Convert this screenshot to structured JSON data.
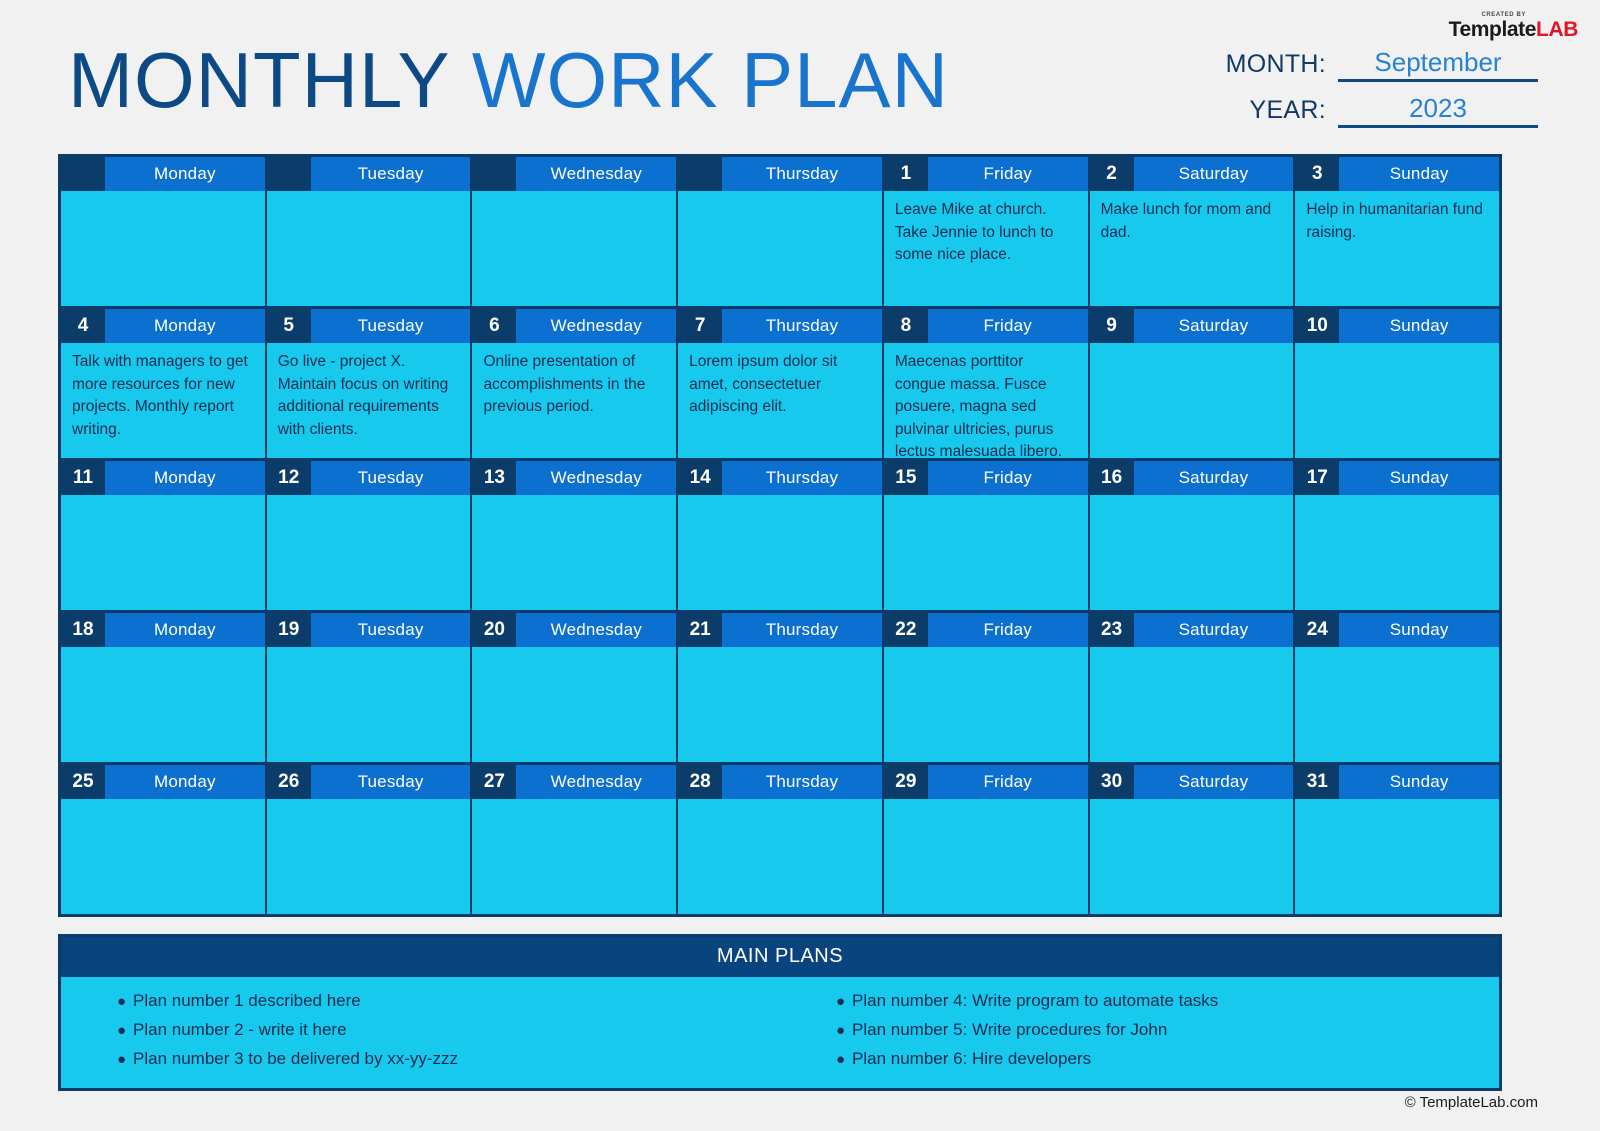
{
  "logo": {
    "creator_text": "CREATED BY",
    "template": "Template",
    "lab": "LAB"
  },
  "header": {
    "title_part1": "MONTHLY ",
    "title_part2": "WORK PLAN",
    "month_label": "MONTH:",
    "month_value": "September",
    "year_label": "YEAR:",
    "year_value": "2023"
  },
  "colors": {
    "dark_navy": "#0c3c6a",
    "header_blue": "#0b70d0",
    "cell_cyan": "#17c9ed",
    "title_dark": "#0d4a85",
    "title_light": "#1874cd",
    "mainplans_header": "#0a447f",
    "text_navy": "#0d2d52",
    "logo_red": "#e0152b",
    "page_bg": "#f1f1f1"
  },
  "calendar": {
    "weeks": [
      {
        "days": [
          {
            "num": "",
            "name": "Monday",
            "note": ""
          },
          {
            "num": "",
            "name": "Tuesday",
            "note": ""
          },
          {
            "num": "",
            "name": "Wednesday",
            "note": ""
          },
          {
            "num": "",
            "name": "Thursday",
            "note": ""
          },
          {
            "num": "1",
            "name": "Friday",
            "note": "Leave Mike at church. Take Jennie to lunch to some nice place."
          },
          {
            "num": "2",
            "name": "Saturday",
            "note": "Make lunch for mom and dad."
          },
          {
            "num": "3",
            "name": "Sunday",
            "note": "Help in humanitarian fund raising."
          }
        ]
      },
      {
        "days": [
          {
            "num": "4",
            "name": "Monday",
            "note": "Talk with managers to get more resources for new projects. Monthly report writing."
          },
          {
            "num": "5",
            "name": "Tuesday",
            "note": "Go live - project X. Maintain focus on writing additional requirements with clients."
          },
          {
            "num": "6",
            "name": "Wednesday",
            "note": "Online presentation of accomplishments in the previous period."
          },
          {
            "num": "7",
            "name": "Thursday",
            "note": "Lorem ipsum dolor sit amet, consectetuer adipiscing elit."
          },
          {
            "num": "8",
            "name": "Friday",
            "note": "Maecenas porttitor congue massa. Fusce posuere, magna sed pulvinar ultricies, purus lectus malesuada libero."
          },
          {
            "num": "9",
            "name": "Saturday",
            "note": ""
          },
          {
            "num": "10",
            "name": "Sunday",
            "note": ""
          }
        ]
      },
      {
        "days": [
          {
            "num": "11",
            "name": "Monday",
            "note": ""
          },
          {
            "num": "12",
            "name": "Tuesday",
            "note": ""
          },
          {
            "num": "13",
            "name": "Wednesday",
            "note": ""
          },
          {
            "num": "14",
            "name": "Thursday",
            "note": ""
          },
          {
            "num": "15",
            "name": "Friday",
            "note": ""
          },
          {
            "num": "16",
            "name": "Saturday",
            "note": ""
          },
          {
            "num": "17",
            "name": "Sunday",
            "note": ""
          }
        ]
      },
      {
        "days": [
          {
            "num": "18",
            "name": "Monday",
            "note": ""
          },
          {
            "num": "19",
            "name": "Tuesday",
            "note": ""
          },
          {
            "num": "20",
            "name": "Wednesday",
            "note": ""
          },
          {
            "num": "21",
            "name": "Thursday",
            "note": ""
          },
          {
            "num": "22",
            "name": "Friday",
            "note": ""
          },
          {
            "num": "23",
            "name": "Saturday",
            "note": ""
          },
          {
            "num": "24",
            "name": "Sunday",
            "note": ""
          }
        ]
      },
      {
        "days": [
          {
            "num": "25",
            "name": "Monday",
            "note": ""
          },
          {
            "num": "26",
            "name": "Tuesday",
            "note": ""
          },
          {
            "num": "27",
            "name": "Wednesday",
            "note": ""
          },
          {
            "num": "28",
            "name": "Thursday",
            "note": ""
          },
          {
            "num": "29",
            "name": "Friday",
            "note": ""
          },
          {
            "num": "30",
            "name": "Saturday",
            "note": ""
          },
          {
            "num": "31",
            "name": "Sunday",
            "note": ""
          }
        ]
      }
    ]
  },
  "main_plans": {
    "header": "MAIN PLANS",
    "bullet": "●",
    "left_column": [
      "Plan number 1 described here",
      "Plan number 2 - write it here",
      "Plan number 3 to be delivered by xx-yy-zzz"
    ],
    "right_column": [
      "Plan number 4: Write program to automate tasks",
      "Plan number 5: Write procedures for John",
      "Plan number 6: Hire developers"
    ]
  },
  "footer": {
    "copyright": "© TemplateLab.com"
  }
}
